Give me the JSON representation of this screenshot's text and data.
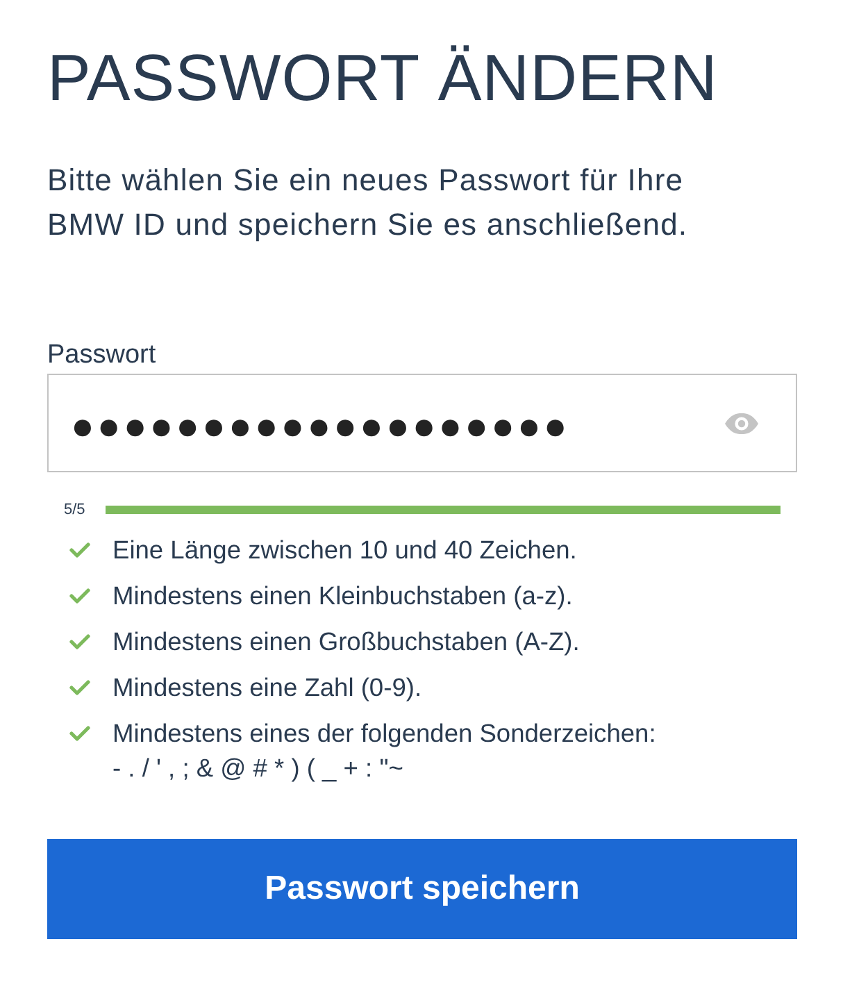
{
  "title": "PASSWORT ÄNDERN",
  "intro": "Bitte wählen Sie ein neues Passwort für Ihre BMW ID und speichern Sie es anschließend.",
  "password": {
    "label": "Passwort",
    "value": "●●●●●●●●●●●●●●●●●●●",
    "visible": false
  },
  "strength": {
    "label": "5/5",
    "level": 1
  },
  "criteria": [
    {
      "text": "Eine Länge zwischen 10 und 40 Zeichen.",
      "met": true
    },
    {
      "text": "Mindestens einen Kleinbuchstaben (a-z).",
      "met": true
    },
    {
      "text": "Mindestens einen Großbuchstaben (A-Z).",
      "met": true
    },
    {
      "text": "Mindestens eine Zahl (0-9).",
      "met": true
    },
    {
      "text": "Mindestens eines der folgenden Sonderzeichen:",
      "note": "- . / ' , ; & @ # * ) ( _ + : \"~",
      "met": true
    }
  ],
  "submit": {
    "label": "Passwort speichern"
  }
}
